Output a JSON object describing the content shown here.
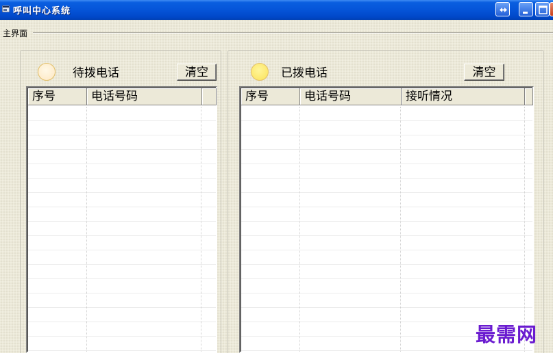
{
  "window": {
    "title": "呼叫中心系统",
    "controls": [
      "resize-icon",
      "minimize-icon",
      "maximize-icon",
      "close-icon"
    ]
  },
  "main": {
    "caption": "主界面"
  },
  "pending": {
    "label": "待拨电话",
    "clear_label": "清空",
    "indicator_color": "#fde7c2",
    "columns": [
      "序号",
      "电话号码",
      ""
    ],
    "rows": []
  },
  "dialed": {
    "label": "已拨电话",
    "clear_label": "清空",
    "indicator_color": "#fbe25a",
    "columns": [
      "序号",
      "电话号码",
      "接听情况",
      ""
    ],
    "rows": []
  },
  "watermark": "最需网",
  "colors": {
    "titlebar": "#0554d8",
    "face": "#ece9d8",
    "watermark": "#6a1bd0"
  }
}
